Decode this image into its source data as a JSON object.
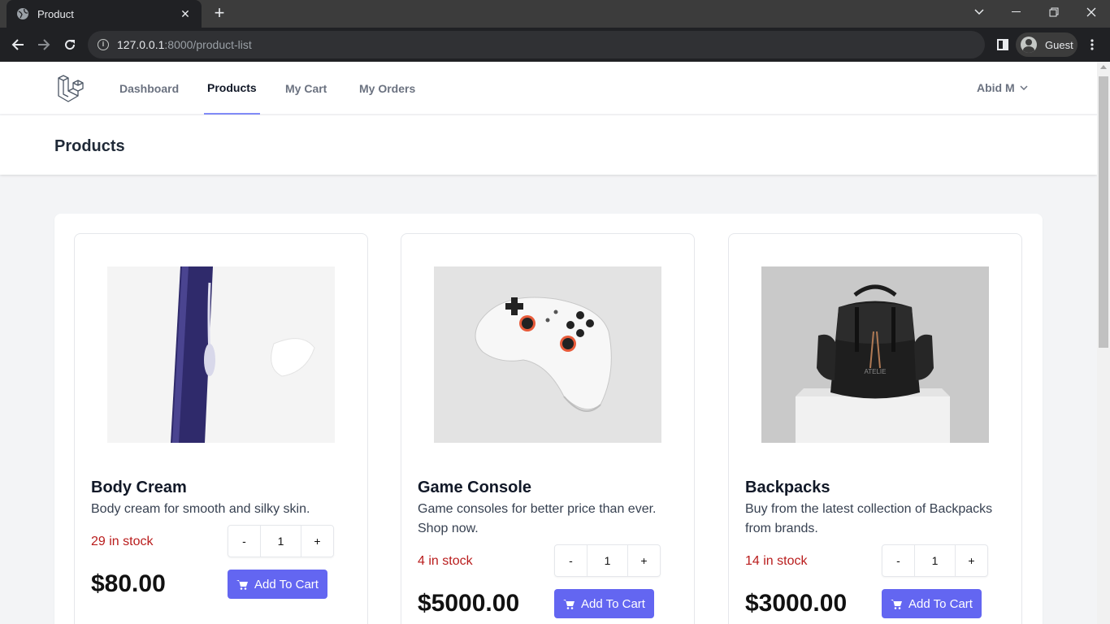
{
  "browser": {
    "tab_title": "Product",
    "url_host": "127.0.0.1",
    "url_path": ":8000/product-list",
    "profile_name": "Guest"
  },
  "nav": {
    "links": [
      "Dashboard",
      "Products",
      "My Cart",
      "My Orders"
    ],
    "active": "Products",
    "user_name": "Abid M"
  },
  "header": {
    "title": "Products"
  },
  "products": [
    {
      "name": "Body Cream",
      "description": "Body cream for smooth and silky skin.",
      "stock": "29 in stock",
      "quantity": "1",
      "price": "$80.00",
      "button": "Add To Cart"
    },
    {
      "name": "Game Console",
      "description": "Game consoles for better price than ever. Shop now.",
      "stock": "4 in stock",
      "quantity": "1",
      "price": "$5000.00",
      "button": "Add To Cart"
    },
    {
      "name": "Backpacks",
      "description": "Buy from the latest collection of Backpacks from brands.",
      "stock": "14 in stock",
      "quantity": "1",
      "price": "$3000.00",
      "button": "Add To Cart"
    }
  ],
  "qty_minus": "-",
  "qty_plus": "+",
  "colors": {
    "accent": "#6366f1",
    "stock": "#b91c1c",
    "nav_active_underline": "#818cf8"
  }
}
